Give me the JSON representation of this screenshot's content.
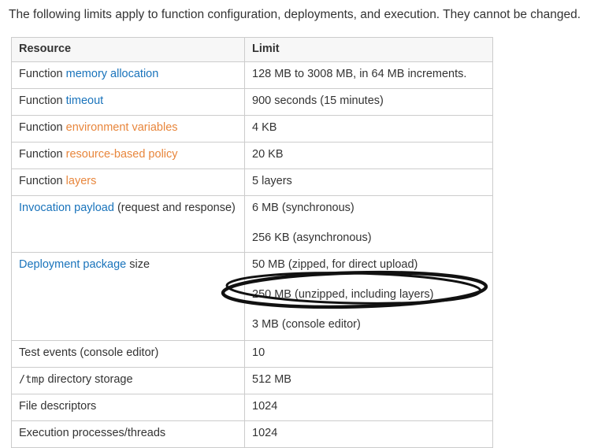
{
  "intro": "The following limits apply to function configuration, deployments, and execution. They cannot be changed.",
  "colors": {
    "text": "#333333",
    "link_blue": "#1973bb",
    "link_orange": "#e8863c",
    "table_border": "#cccccc",
    "header_bg": "#f7f7f7",
    "annotation_stroke": "#111111"
  },
  "table": {
    "headers": [
      "Resource",
      "Limit"
    ],
    "rows": [
      {
        "resource": [
          {
            "t": "Function ",
            "s": "plain"
          },
          {
            "t": "memory allocation",
            "s": "link-blue"
          }
        ],
        "limit": [
          "128 MB to 3008 MB, in 64 MB increments."
        ]
      },
      {
        "resource": [
          {
            "t": "Function ",
            "s": "plain"
          },
          {
            "t": "timeout",
            "s": "link-blue"
          }
        ],
        "limit": [
          "900 seconds (15 minutes)"
        ]
      },
      {
        "resource": [
          {
            "t": "Function ",
            "s": "plain"
          },
          {
            "t": "environment variables",
            "s": "link-orange"
          }
        ],
        "limit": [
          "4 KB"
        ]
      },
      {
        "resource": [
          {
            "t": "Function ",
            "s": "plain"
          },
          {
            "t": "resource-based policy",
            "s": "link-orange"
          }
        ],
        "limit": [
          "20 KB"
        ]
      },
      {
        "resource": [
          {
            "t": "Function ",
            "s": "plain"
          },
          {
            "t": "layers",
            "s": "link-orange"
          }
        ],
        "limit": [
          "5 layers"
        ]
      },
      {
        "resource": [
          {
            "t": "Invocation payload",
            "s": "link-blue"
          },
          {
            "t": " (request and response)",
            "s": "plain"
          }
        ],
        "limit": [
          "6 MB (synchronous)",
          "256 KB (asynchronous)"
        ]
      },
      {
        "resource": [
          {
            "t": "Deployment package",
            "s": "link-blue"
          },
          {
            "t": " size",
            "s": "plain"
          }
        ],
        "limit": [
          "50 MB (zipped, for direct upload)",
          "250 MB (unzipped, including layers)",
          "3 MB (console editor)"
        ]
      },
      {
        "resource": [
          {
            "t": "Test events (console editor)",
            "s": "plain"
          }
        ],
        "limit": [
          "10"
        ]
      },
      {
        "resource": [
          {
            "t": "/tmp",
            "s": "mono"
          },
          {
            "t": " directory storage",
            "s": "plain"
          }
        ],
        "limit": [
          "512 MB"
        ]
      },
      {
        "resource": [
          {
            "t": "File descriptors",
            "s": "plain"
          }
        ],
        "limit": [
          "1024"
        ]
      },
      {
        "resource": [
          {
            "t": "Execution processes/threads",
            "s": "plain"
          }
        ],
        "limit": [
          "1024"
        ]
      }
    ]
  },
  "annotation": {
    "shape": "hand-drawn-ellipse",
    "around": "250 MB (unzipped, including layers)"
  }
}
